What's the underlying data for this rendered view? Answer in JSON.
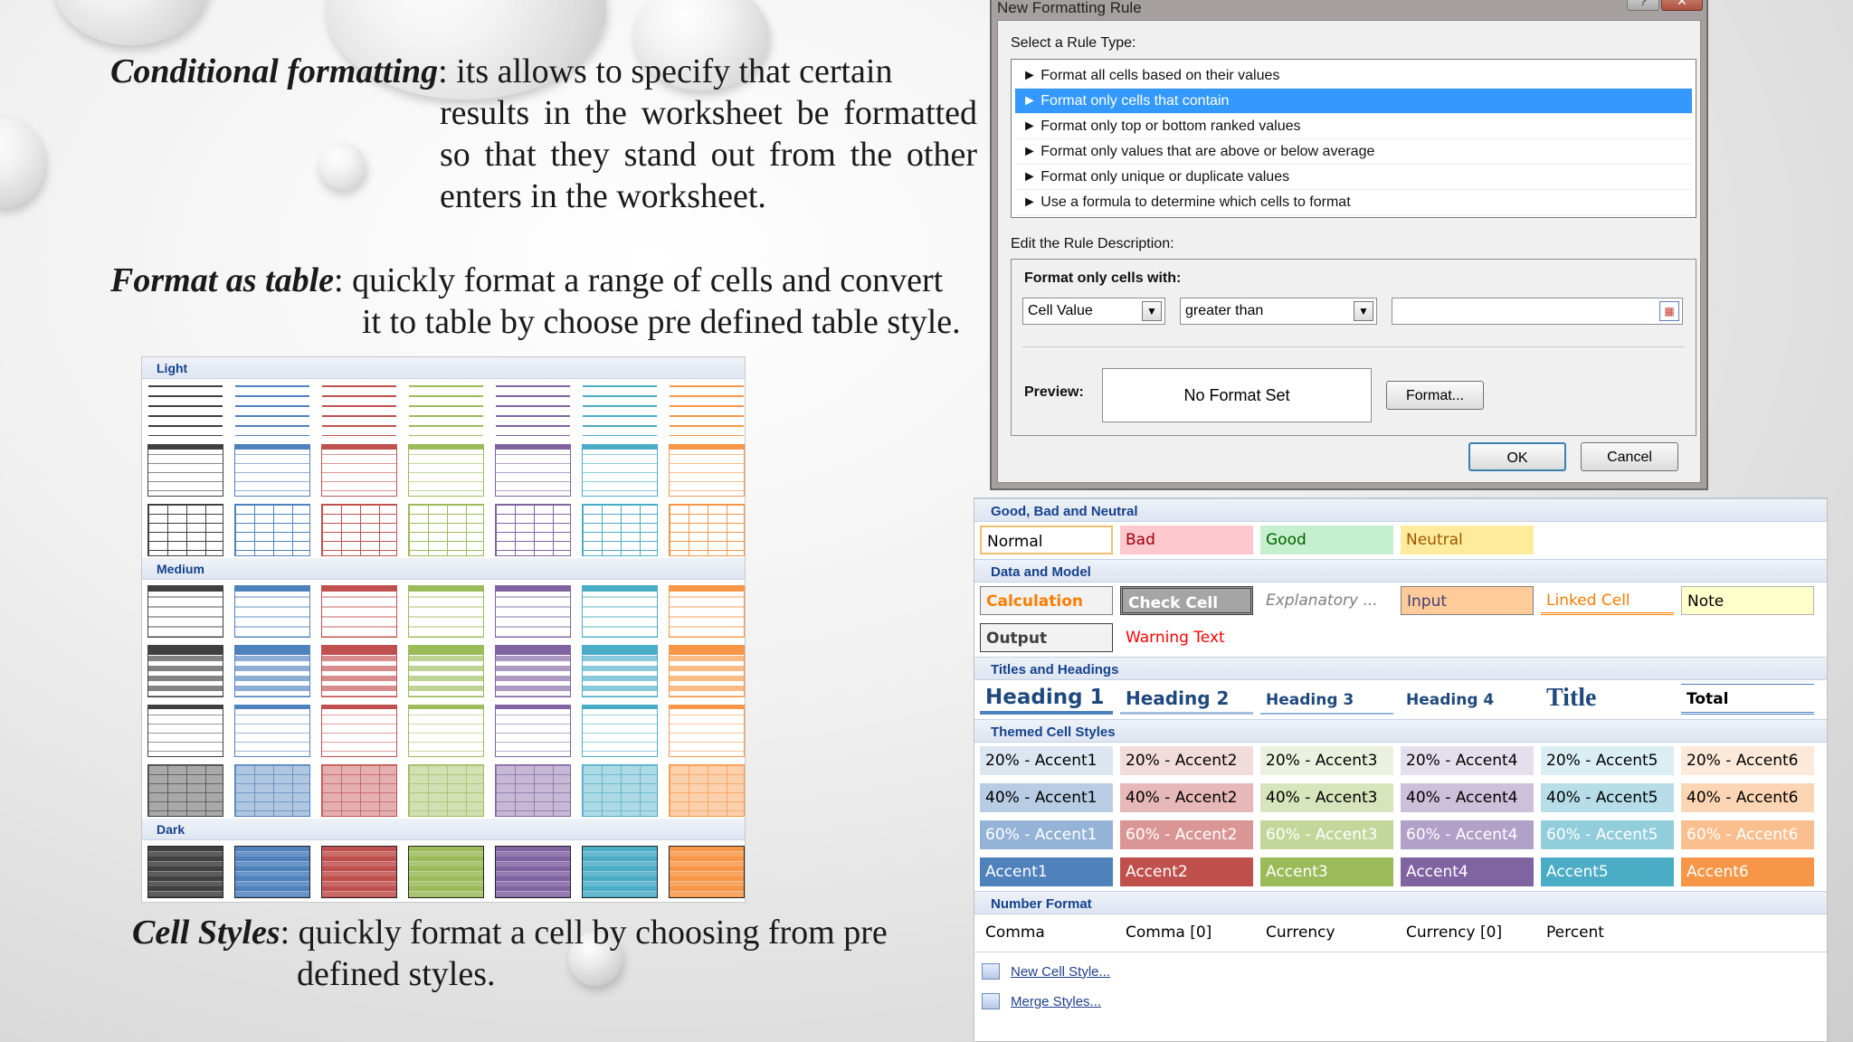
{
  "slide": {
    "cf_term": "Conditional formatting",
    "cf_text1": ": its allows to specify that certain",
    "cf_text2": "results in the worksheet be formatted so that they stand out from the other enters in the worksheet.",
    "ft_term": "Format as table",
    "ft_text1": ": quickly format a range of cells and convert",
    "ft_text2": "it to table by choose pre defined table style.",
    "cs_term": "Cell Styles",
    "cs_text1": ": quickly format a cell by choosing from pre",
    "cs_text2": "defined styles."
  },
  "table_styles": {
    "sections": [
      "Light",
      "Medium",
      "Dark"
    ],
    "colors": [
      "#404040",
      "#4f81bd",
      "#c0504d",
      "#9bbb59",
      "#8064a2",
      "#4bacc6",
      "#f79646"
    ]
  },
  "dialog": {
    "title": "New Formatting Rule",
    "select_rule_label": "Select a Rule Type:",
    "rules": [
      "► Format all cells based on their values",
      "► Format only cells that contain",
      "► Format only top or bottom ranked values",
      "► Format only values that are above or below average",
      "► Format only unique or duplicate values",
      "► Use a formula to determine which cells to format"
    ],
    "selected_rule": 1,
    "edit_desc_label": "Edit the Rule Description:",
    "format_with_label": "Format only cells with:",
    "combo1": "Cell Value",
    "combo2": "greater than",
    "value_input": "",
    "preview_label": "Preview:",
    "preview_text": "No Format Set",
    "format_button": "Format...",
    "ok": "OK",
    "cancel": "Cancel",
    "help": "?",
    "close": "✕"
  },
  "cell_styles": {
    "good_bad_header": "Good, Bad and Neutral",
    "good_bad": [
      "Normal",
      "Bad",
      "Good",
      "Neutral"
    ],
    "data_model_header": "Data and Model",
    "data_model_row1": [
      "Calculation",
      "Check Cell",
      "Explanatory ...",
      "Input",
      "Linked Cell",
      "Note"
    ],
    "data_model_row2": [
      "Output",
      "Warning Text"
    ],
    "titles_header": "Titles and Headings",
    "titles": [
      "Heading 1",
      "Heading 2",
      "Heading 3",
      "Heading 4",
      "Title",
      "Total"
    ],
    "themed_header": "Themed Cell Styles",
    "themed_20": [
      "20% - Accent1",
      "20% - Accent2",
      "20% - Accent3",
      "20% - Accent4",
      "20% - Accent5",
      "20% - Accent6"
    ],
    "themed_40": [
      "40% - Accent1",
      "40% - Accent2",
      "40% - Accent3",
      "40% - Accent4",
      "40% - Accent5",
      "40% - Accent6"
    ],
    "themed_60": [
      "60% - Accent1",
      "60% - Accent2",
      "60% - Accent3",
      "60% - Accent4",
      "60% - Accent5",
      "60% - Accent6"
    ],
    "themed_accent": [
      "Accent1",
      "Accent2",
      "Accent3",
      "Accent4",
      "Accent5",
      "Accent6"
    ],
    "number_header": "Number Format",
    "number": [
      "Comma",
      "Comma [0]",
      "Currency",
      "Currency [0]",
      "Percent"
    ],
    "new_style": "New Cell Style...",
    "merge_styles": "Merge Styles..."
  }
}
